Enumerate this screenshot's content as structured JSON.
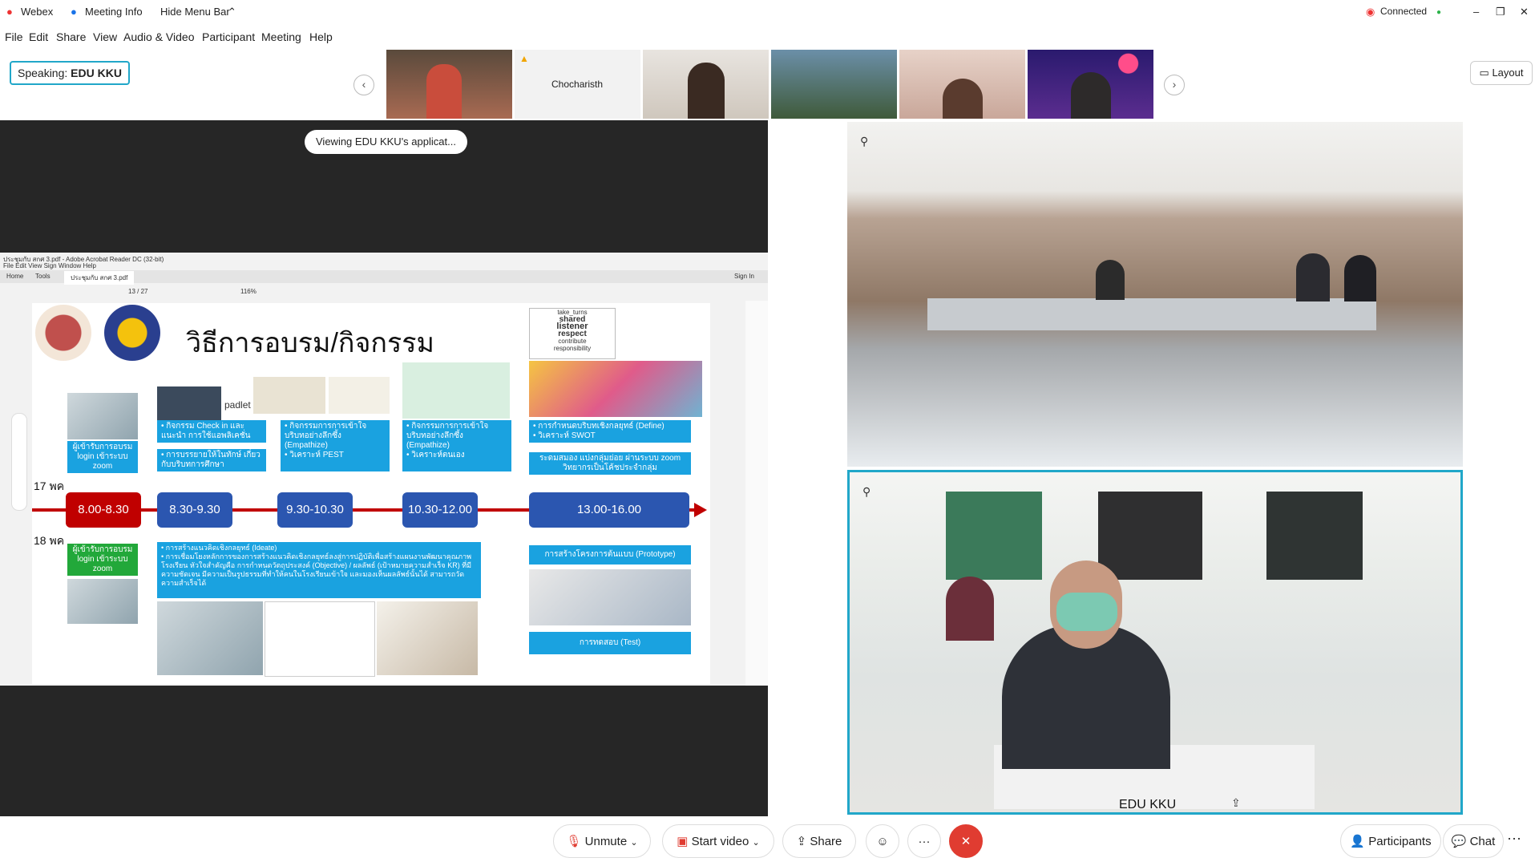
{
  "titlebar": {
    "app": "Webex",
    "meeting_info": "Meeting Info",
    "hide_menu": "Hide Menu Bar",
    "status": "Connected"
  },
  "menu": [
    "File",
    "Edit",
    "Share",
    "View",
    "Audio & Video",
    "Participant",
    "Meeting",
    "Help"
  ],
  "speaking": {
    "label": "Speaking:",
    "name": "EDU KKU"
  },
  "thumbnails": {
    "named": "Chocharisth"
  },
  "layout_label": "Layout",
  "viewing_label": "Viewing EDU KKU's applicat...",
  "acrobat": {
    "title": "ประชุมกับ สกศ 3.pdf - Adobe Acrobat Reader DC (32-bit)",
    "menu": [
      "File",
      "Edit",
      "View",
      "Sign",
      "Window",
      "Help"
    ],
    "tabs": [
      "Home",
      "Tools",
      "ประชุมกับ สกศ 3.pdf"
    ],
    "sign_in": "Sign In",
    "page": "13 / 27",
    "zoom": "116%"
  },
  "slide": {
    "title": "วิธีการอบรม/กิจกรรม",
    "padlet": "padlet",
    "day1": "17 พค",
    "day2": "18 พค",
    "login1": "ผู้เข้ารับการอบรม login เข้าระบบ zoom",
    "login2": "ผู้เข้ารับการอบรม login เข้าระบบ zoom",
    "times": [
      "8.00-8.30",
      "8.30-9.30",
      "9.30-10.30",
      "10.30-12.00",
      "13.00-16.00"
    ],
    "box_checkin": "• กิจกรรม Check in และแนะนำ การใช้แอพลิเคชั่น",
    "box_lecture": "• การบรรยายให้ในทักษ์ เกี่ยวกับบริบทการศึกษา",
    "box_empathize1": "• กิจกรรมการการเข้าใจ บริบทอย่างลึกซึ้ง (Empathize)\n• วิเคราะห์ PEST",
    "box_empathize2": "• กิจกรรมการการเข้าใจ บริบทอย่างลึกซึ้ง (Empathize)\n• วิเคราะห์ตนเอง",
    "box_define": "• การกำหนดบริบทเชิงกลยุทธ์ (Define)\n• วิเคราะห์ SWOT",
    "box_zoom": "ระดมสมอง แบ่งกลุ่มย่อย ผ่านระบบ zoom วิทยากรเป็นโค้ชประจำกลุ่ม",
    "box_ideate": "• การสร้างแนวคิดเชิงกลยุทธ์ (Ideate)\n• การเชื่อมโยงหลักการของการสร้างแนวคิดเชิงกลยุทธ์ลงสู่การปฏิบัติเพื่อสร้างแผนงานพัฒนาคุณภาพโรงเรียน หัวใจสำคัญคือ การกำหนดวัตถุประสงค์ (Objective) / ผลลัพธ์ (เป้าหมายความสำเร็จ KR) ที่มีความชัดเจน มีความเป็นรูปธรรมที่ทำให้คนในโรงเรียนเข้าใจ และมองเห็นผลลัพธ์นั้นได้ สามารถวัดความสำเร็จได้",
    "box_prototype": "การสร้างโครงการต้นแบบ (Prototype)",
    "box_test": "การทดสอบ (Test)",
    "words": [
      "take_turns",
      "shared",
      "listener",
      "respect",
      "contribute",
      "responsibility"
    ]
  },
  "video_main": {
    "name": "EDU KKU"
  },
  "bottom": {
    "unmute": "Unmute",
    "start_video": "Start video",
    "share": "Share",
    "more": "···",
    "end": "✕",
    "participants": "Participants",
    "chat": "Chat"
  },
  "colors": {
    "accent": "#21a7c9",
    "end_red": "#e03c31",
    "timeline_red": "#c00000",
    "slide_blue": "#1aa2e0"
  }
}
